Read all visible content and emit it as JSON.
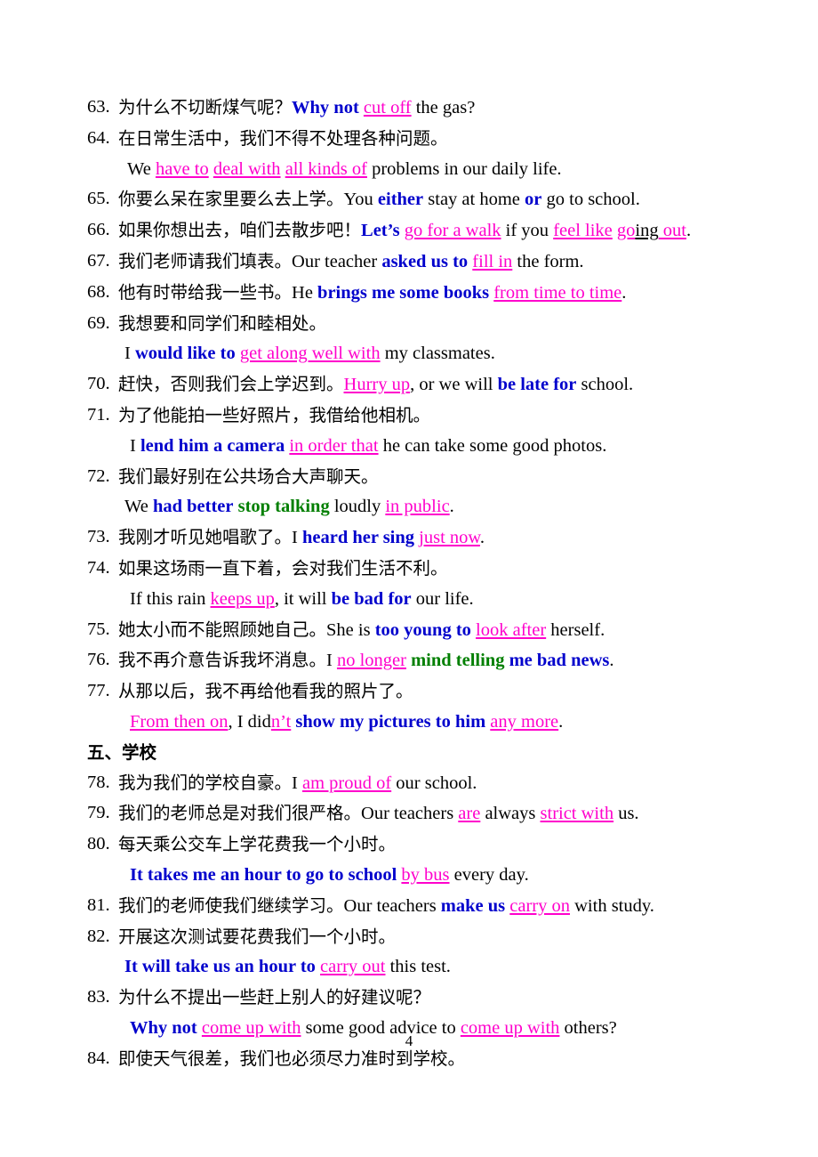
{
  "page": {
    "page_number": "4",
    "colors": {
      "black": "#000000",
      "blue": "#0000CC",
      "green": "#007F00",
      "magenta": "#FF00CC",
      "background": "#FFFFFF"
    }
  },
  "lines": [
    {
      "id": "item-63",
      "type": "entry",
      "number": "63.",
      "runs": [
        {
          "t": "为什么不切断煤气呢？",
          "s": "cn k"
        },
        {
          "t": "Why not ",
          "s": "b"
        },
        {
          "t": "cut off",
          "s": "m"
        },
        {
          "t": " the gas?",
          "s": "k"
        }
      ]
    },
    {
      "id": "item-64",
      "type": "entry",
      "number": "64.",
      "runs": [
        {
          "t": "在日常生活中，我们不得不处理各种问题。",
          "s": "cn k"
        }
      ]
    },
    {
      "id": "item-64-answer",
      "type": "cont",
      "indent": "i1",
      "runs": [
        {
          "t": "We ",
          "s": "k"
        },
        {
          "t": "have to",
          "s": "m"
        },
        {
          "t": " ",
          "s": "k"
        },
        {
          "t": "deal with",
          "s": "m"
        },
        {
          "t": " ",
          "s": "k"
        },
        {
          "t": "all kinds of",
          "s": "m"
        },
        {
          "t": " problems in our daily life.",
          "s": "k"
        }
      ]
    },
    {
      "id": "item-65",
      "type": "entry",
      "number": "65.",
      "runs": [
        {
          "t": "你要么呆在家里要么去上学。",
          "s": "cn k"
        },
        {
          "t": "You ",
          "s": "k"
        },
        {
          "t": "either",
          "s": "b"
        },
        {
          "t": " stay at home ",
          "s": "k"
        },
        {
          "t": "or",
          "s": "b"
        },
        {
          "t": " go to school.",
          "s": "k"
        }
      ]
    },
    {
      "id": "item-66",
      "type": "entry",
      "number": "66.",
      "runs": [
        {
          "t": "如果你想出去，咱们去散步吧！",
          "s": "cn k"
        },
        {
          "t": "Let’s ",
          "s": "b"
        },
        {
          "t": "go for a walk",
          "s": "m"
        },
        {
          "t": " if you ",
          "s": "k"
        },
        {
          "t": "feel like",
          "s": "m"
        },
        {
          "t": " ",
          "s": "k"
        },
        {
          "t": "go",
          "s": "m"
        },
        {
          "t": "ing",
          "s": "ku"
        },
        {
          "t": " out",
          "s": "m"
        },
        {
          "t": ".",
          "s": "k"
        }
      ]
    },
    {
      "id": "item-67",
      "type": "entry",
      "number": "67.",
      "runs": [
        {
          "t": "我们老师请我们填表。",
          "s": "cn k"
        },
        {
          "t": "Our teacher ",
          "s": "k"
        },
        {
          "t": "asked us to",
          "s": "b"
        },
        {
          "t": " ",
          "s": "k"
        },
        {
          "t": "fill in",
          "s": "m"
        },
        {
          "t": " the form.",
          "s": "k"
        }
      ]
    },
    {
      "id": "item-68",
      "type": "entry",
      "number": "68.",
      "runs": [
        {
          "t": "他有时带给我一些书。",
          "s": "cn k"
        },
        {
          "t": "He ",
          "s": "k"
        },
        {
          "t": "brings me some books",
          "s": "b"
        },
        {
          "t": " ",
          "s": "k"
        },
        {
          "t": "from time to time",
          "s": "m"
        },
        {
          "t": ".",
          "s": "k"
        }
      ]
    },
    {
      "id": "item-69",
      "type": "entry",
      "number": "69.",
      "runs": [
        {
          "t": "我想要和同学们和睦相处。",
          "s": "cn k"
        }
      ]
    },
    {
      "id": "item-69-answer",
      "type": "cont",
      "indent": "i2",
      "runs": [
        {
          "t": "I ",
          "s": "k"
        },
        {
          "t": "would like to",
          "s": "b"
        },
        {
          "t": " ",
          "s": "k"
        },
        {
          "t": "get along well with",
          "s": "m"
        },
        {
          "t": " my classmates.",
          "s": "k"
        }
      ]
    },
    {
      "id": "item-70",
      "type": "entry",
      "number": "70.",
      "runs": [
        {
          "t": "赶快，否则我们会上学迟到。",
          "s": "cn k"
        },
        {
          "t": "Hurry up",
          "s": "m"
        },
        {
          "t": ", or we will ",
          "s": "k"
        },
        {
          "t": "be late for",
          "s": "b"
        },
        {
          "t": " school.",
          "s": "k"
        }
      ]
    },
    {
      "id": "item-71",
      "type": "entry",
      "number": "71.",
      "runs": [
        {
          "t": "为了他能拍一些好照片，我借给他相机。",
          "s": "cn k"
        }
      ]
    },
    {
      "id": "item-71-answer",
      "type": "cont",
      "indent": "i3",
      "runs": [
        {
          "t": "I ",
          "s": "k"
        },
        {
          "t": "lend him a camera",
          "s": "b"
        },
        {
          "t": " ",
          "s": "k"
        },
        {
          "t": "in order that",
          "s": "m"
        },
        {
          "t": " he can take some good photos.",
          "s": "k"
        }
      ]
    },
    {
      "id": "item-72",
      "type": "entry",
      "number": "72.",
      "runs": [
        {
          "t": "我们最好别在公共场合大声聊天。",
          "s": "cn k"
        }
      ]
    },
    {
      "id": "item-72-answer",
      "type": "cont",
      "indent": "i2",
      "runs": [
        {
          "t": "We ",
          "s": "k"
        },
        {
          "t": "had better",
          "s": "b"
        },
        {
          "t": " ",
          "s": "k"
        },
        {
          "t": "stop talking",
          "s": "g"
        },
        {
          "t": " loudly ",
          "s": "k"
        },
        {
          "t": "in public",
          "s": "m"
        },
        {
          "t": ".",
          "s": "k"
        }
      ]
    },
    {
      "id": "item-73",
      "type": "entry",
      "number": "73.",
      "runs": [
        {
          "t": "我刚才听见她唱歌了。",
          "s": "cn k"
        },
        {
          "t": "I ",
          "s": "k"
        },
        {
          "t": "heard her sing",
          "s": "b"
        },
        {
          "t": " ",
          "s": "k"
        },
        {
          "t": "just now",
          "s": "m"
        },
        {
          "t": ".",
          "s": "k"
        }
      ]
    },
    {
      "id": "item-74",
      "type": "entry",
      "number": "74.",
      "runs": [
        {
          "t": "如果这场雨一直下着，会对我们生活不利。",
          "s": "cn k"
        }
      ]
    },
    {
      "id": "item-74-answer",
      "type": "cont",
      "indent": "i3",
      "runs": [
        {
          "t": "If this rain ",
          "s": "k"
        },
        {
          "t": "keeps up",
          "s": "m"
        },
        {
          "t": ", it will ",
          "s": "k"
        },
        {
          "t": "be bad for",
          "s": "b"
        },
        {
          "t": " our life.",
          "s": "k"
        }
      ]
    },
    {
      "id": "item-75",
      "type": "entry",
      "number": "75.",
      "runs": [
        {
          "t": "她太小而不能照顾她自己。",
          "s": "cn k"
        },
        {
          "t": "She is ",
          "s": "k"
        },
        {
          "t": "too young to",
          "s": "b"
        },
        {
          "t": " ",
          "s": "k"
        },
        {
          "t": "look after",
          "s": "m"
        },
        {
          "t": " herself.",
          "s": "k"
        }
      ]
    },
    {
      "id": "item-76",
      "type": "entry",
      "number": "76.",
      "runs": [
        {
          "t": "我不再介意告诉我坏消息。",
          "s": "cn k"
        },
        {
          "t": "I ",
          "s": "k"
        },
        {
          "t": "no longer",
          "s": "m"
        },
        {
          "t": " ",
          "s": "k"
        },
        {
          "t": "mind telling",
          "s": "g"
        },
        {
          "t": " ",
          "s": "k"
        },
        {
          "t": "me bad news",
          "s": "b"
        },
        {
          "t": ".",
          "s": "k"
        }
      ]
    },
    {
      "id": "item-77",
      "type": "entry",
      "number": "77.",
      "runs": [
        {
          "t": "从那以后，我不再给他看我的照片了。",
          "s": "cn k"
        }
      ]
    },
    {
      "id": "item-77-answer",
      "type": "cont",
      "indent": "i3",
      "runs": [
        {
          "t": "From then on",
          "s": "m"
        },
        {
          "t": ", I did",
          "s": "k"
        },
        {
          "t": "n’t",
          "s": "mu"
        },
        {
          "t": " ",
          "s": "k"
        },
        {
          "t": "show my pictures to him",
          "s": "b"
        },
        {
          "t": " ",
          "s": "k"
        },
        {
          "t": "any more",
          "s": "m"
        },
        {
          "t": ".",
          "s": "k"
        }
      ]
    },
    {
      "id": "section-five-school",
      "type": "section",
      "runs": [
        {
          "t": "五、学校",
          "s": "cn k"
        }
      ]
    },
    {
      "id": "item-78",
      "type": "entry",
      "number": "78.",
      "runs": [
        {
          "t": "我为我们的学校自豪。",
          "s": "cn k"
        },
        {
          "t": "I ",
          "s": "k"
        },
        {
          "t": "am proud of",
          "s": "m"
        },
        {
          "t": " our school.",
          "s": "k"
        }
      ]
    },
    {
      "id": "item-79",
      "type": "entry",
      "number": "79.",
      "runs": [
        {
          "t": "我们的老师总是对我们很严格。",
          "s": "cn k"
        },
        {
          "t": "Our teachers ",
          "s": "k"
        },
        {
          "t": "are",
          "s": "m"
        },
        {
          "t": " always ",
          "s": "k"
        },
        {
          "t": "strict with",
          "s": "m"
        },
        {
          "t": " us.",
          "s": "k"
        }
      ]
    },
    {
      "id": "item-80",
      "type": "entry",
      "number": "80.",
      "runs": [
        {
          "t": "每天乘公交车上学花费我一个小时。",
          "s": "cn k"
        }
      ]
    },
    {
      "id": "item-80-answer",
      "type": "cont",
      "indent": "i3",
      "runs": [
        {
          "t": "It takes me an hour to go to school",
          "s": "b"
        },
        {
          "t": " ",
          "s": "k"
        },
        {
          "t": "by bus",
          "s": "m"
        },
        {
          "t": " every day.",
          "s": "k"
        }
      ]
    },
    {
      "id": "item-81",
      "type": "entry",
      "number": "81.",
      "runs": [
        {
          "t": "我们的老师使我们继续学习。",
          "s": "cn k"
        },
        {
          "t": "Our teachers ",
          "s": "k"
        },
        {
          "t": "make us",
          "s": "b"
        },
        {
          "t": " ",
          "s": "k"
        },
        {
          "t": "carry on",
          "s": "m"
        },
        {
          "t": " with study.",
          "s": "k"
        }
      ]
    },
    {
      "id": "item-82",
      "type": "entry",
      "number": "82.",
      "runs": [
        {
          "t": "开展这次测试要花费我们一个小时。",
          "s": "cn k"
        }
      ]
    },
    {
      "id": "item-82-answer",
      "type": "cont",
      "indent": "i2",
      "runs": [
        {
          "t": "It will take us an hour to",
          "s": "b"
        },
        {
          "t": " ",
          "s": "k"
        },
        {
          "t": "carry out",
          "s": "m"
        },
        {
          "t": " this test.",
          "s": "k"
        }
      ]
    },
    {
      "id": "item-83",
      "type": "entry",
      "number": "83.",
      "runs": [
        {
          "t": "为什么不提出一些赶上别人的好建议呢？",
          "s": "cn k"
        }
      ]
    },
    {
      "id": "item-83-answer",
      "type": "cont",
      "indent": "i3",
      "runs": [
        {
          "t": "Why not",
          "s": "b"
        },
        {
          "t": " ",
          "s": "k"
        },
        {
          "t": "come up with",
          "s": "m"
        },
        {
          "t": " some good advice to ",
          "s": "k"
        },
        {
          "t": "come up with",
          "s": "m"
        },
        {
          "t": " others?",
          "s": "k"
        }
      ]
    },
    {
      "id": "item-84",
      "type": "entry",
      "number": "84.",
      "runs": [
        {
          "t": "即使天气很差，我们也必须尽力准时到学校。",
          "s": "cn k"
        }
      ]
    }
  ]
}
